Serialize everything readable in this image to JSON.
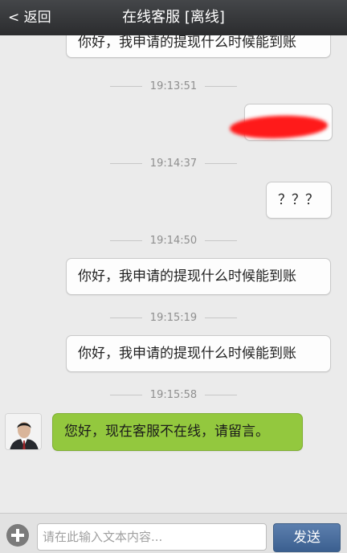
{
  "header": {
    "back_label": "< 返回",
    "title": "在线客服 [离线]"
  },
  "messages": [
    {
      "type": "outgoing",
      "text": "你好，我申请的提现什么时候能到账"
    },
    {
      "type": "time",
      "text": "19:13:51"
    },
    {
      "type": "outgoing-redacted",
      "text": ""
    },
    {
      "type": "time",
      "text": "19:14:37"
    },
    {
      "type": "outgoing",
      "text": "？？？"
    },
    {
      "type": "time",
      "text": "19:14:50"
    },
    {
      "type": "outgoing",
      "text": "你好，我申请的提现什么时候能到账"
    },
    {
      "type": "time",
      "text": "19:15:19"
    },
    {
      "type": "outgoing",
      "text": "你好，我申请的提现什么时候能到账"
    },
    {
      "type": "time",
      "text": "19:15:58"
    },
    {
      "type": "incoming",
      "text": "您好，现在客服不在线，请留言。"
    }
  ],
  "input": {
    "placeholder": "请在此输入文本内容...",
    "value": ""
  },
  "send_label": "发送",
  "colors": {
    "header_bg": "#2b2c2e",
    "incoming_bubble": "#93c83e",
    "outgoing_bubble": "#fdfdfd",
    "send_button": "#3b5f8f",
    "redaction": "#ff1a1a"
  },
  "icons": {
    "add": "plus-circle-icon",
    "agent_avatar": "avatar"
  }
}
